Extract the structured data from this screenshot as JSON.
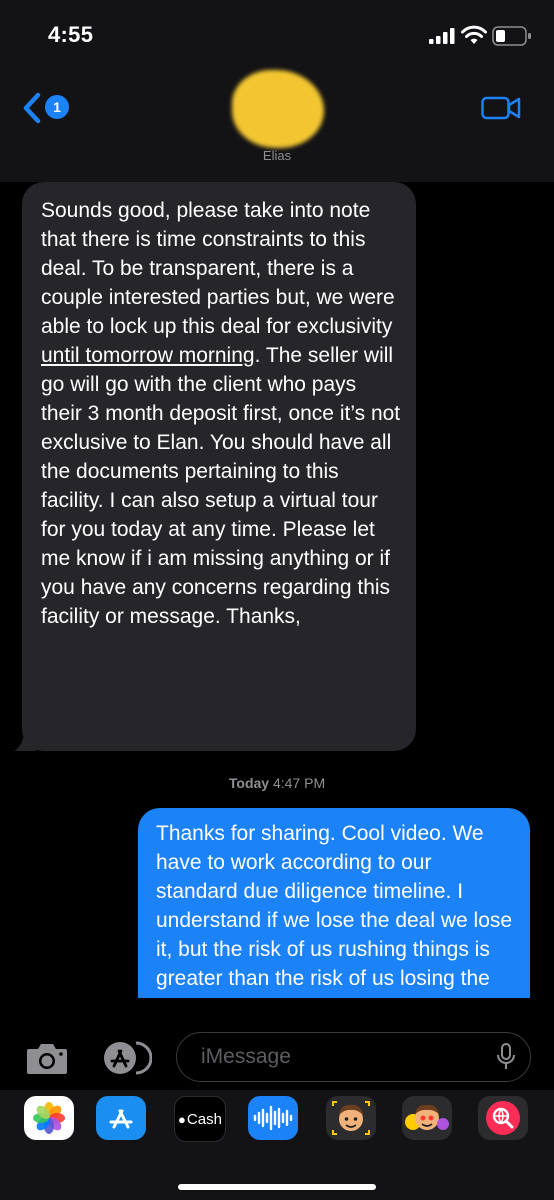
{
  "status": {
    "time": "4:55"
  },
  "header": {
    "back_badge": "1",
    "contact_name": "Elias"
  },
  "messages": {
    "incoming": {
      "text_1": "Sounds good, please take into note that there is time constraints to this deal. To be transparent, there is a couple interested parties but, we were able to lock up this deal for exclusivity ",
      "underlined": "until tomorrow morning",
      "text_2": ". The seller will go will go with the client who pays their 3 month deposit first, once it’s not exclusive to Elan. You should have all the documents pertaining to this facility. I can also setup a virtual tour for you today at any time. Please  let me know if i am missing anything or if you have any concerns regarding this facility or message. Thanks,"
    },
    "timestamp_day": "Today",
    "timestamp_time": " 4:47 PM",
    "outgoing": {
      "text": "Thanks for sharing. Cool video. We have to work according to our standard due diligence timeline. I understand if we lose the deal we lose it, but the risk of us rushing things is greater than the risk of us losing the deal"
    }
  },
  "input": {
    "placeholder": "iMessage"
  },
  "app_drawer": {
    "cash_label": "Cash",
    "apps": [
      "photos-icon",
      "app-store-icon",
      "apple-cash-icon",
      "audio-message-icon",
      "memoji-icon",
      "memoji-stickers-icon",
      "web-search-icon"
    ]
  },
  "colors": {
    "outgoing_bubble": "#1b82f7",
    "incoming_bubble": "#26252a",
    "accent": "#1b82f7"
  }
}
